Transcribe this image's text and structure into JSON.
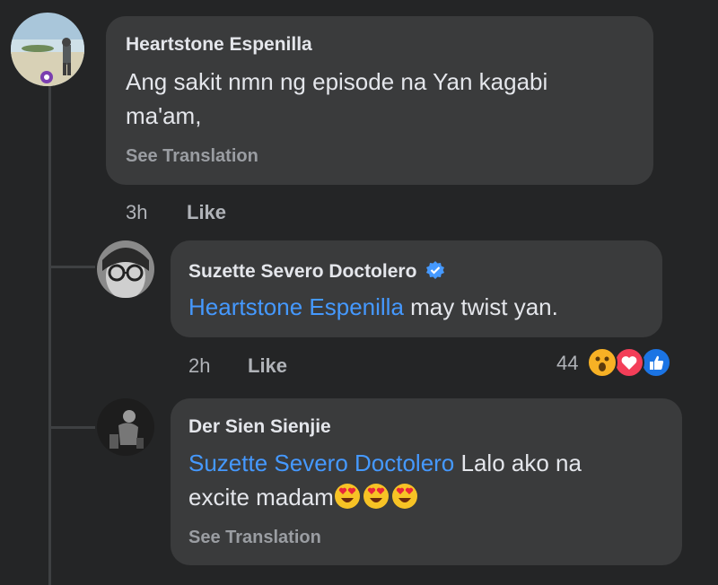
{
  "comments": [
    {
      "author": "Heartstone Espenilla",
      "text_line1": "Ang sakit nmn ng episode na Yan kagabi",
      "text_line2": "ma'am,",
      "see_translation": "See Translation",
      "time": "3h",
      "like_label": "Like"
    },
    {
      "author": "Suzette Severo Doctolero",
      "verified_icon": "verified-badge-icon",
      "mention": "Heartstone Espenilla",
      "text": " may twist yan.",
      "time": "2h",
      "like_label": "Like",
      "reaction_count": "44",
      "reactions": [
        "wow-reaction-icon",
        "love-reaction-icon",
        "like-reaction-icon"
      ]
    },
    {
      "author": "Der Sien Sienjie",
      "mention": "Suzette Severo Doctolero",
      "text": " Lalo ako na",
      "text_line2": "excite madam",
      "emojis": [
        "heart-eyes-emoji",
        "heart-eyes-emoji",
        "heart-eyes-emoji"
      ],
      "see_translation": "See Translation"
    }
  ],
  "colors": {
    "background": "#242526",
    "bubble": "#3a3b3c",
    "mention": "#4599ff",
    "verified": "#4599ff"
  }
}
